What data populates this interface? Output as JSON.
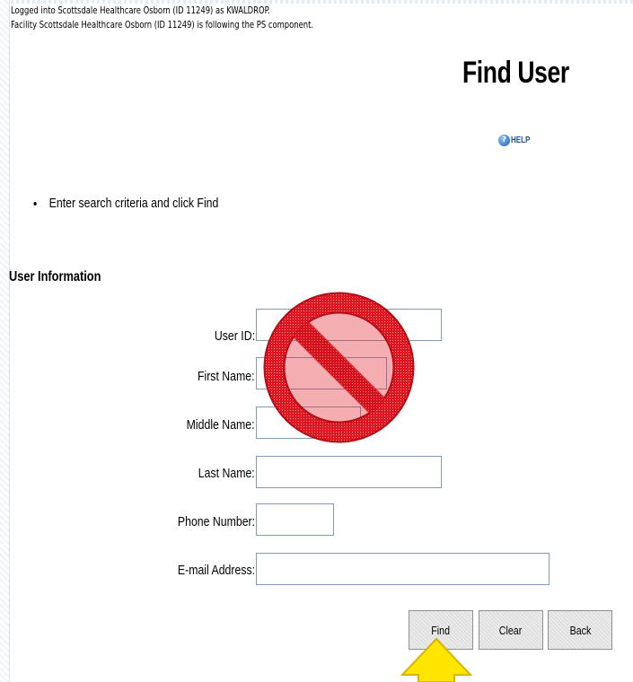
{
  "login": {
    "line1": "Logged into Scottsdale Healthcare Osborn (ID 11249) as KWALDROP.",
    "line2": "Facility Scottsdale Healthcare Osborn (ID 11249) is following the PS component."
  },
  "page": {
    "title": "Find User",
    "help_label": "HELP",
    "help_icon": "?",
    "instruction": "Enter search criteria and click Find"
  },
  "section": {
    "heading": "User Information"
  },
  "fields": {
    "user_id": {
      "label": "User ID:",
      "value": ""
    },
    "first_name": {
      "label": "First Name:",
      "value": ""
    },
    "middle_name": {
      "label": "Middle Name:",
      "value": ""
    },
    "last_name": {
      "label": "Last Name:",
      "value": ""
    },
    "phone": {
      "label": "Phone Number:",
      "value": ""
    },
    "email": {
      "label": "E-mail Address:",
      "value": ""
    }
  },
  "buttons": {
    "find": "Find",
    "clear": "Clear",
    "back": "Back"
  },
  "colors": {
    "no_sign": "#e0141e",
    "arrow": "#ffe600",
    "input_border": "#7f9db9",
    "help": "#1d4f97"
  }
}
